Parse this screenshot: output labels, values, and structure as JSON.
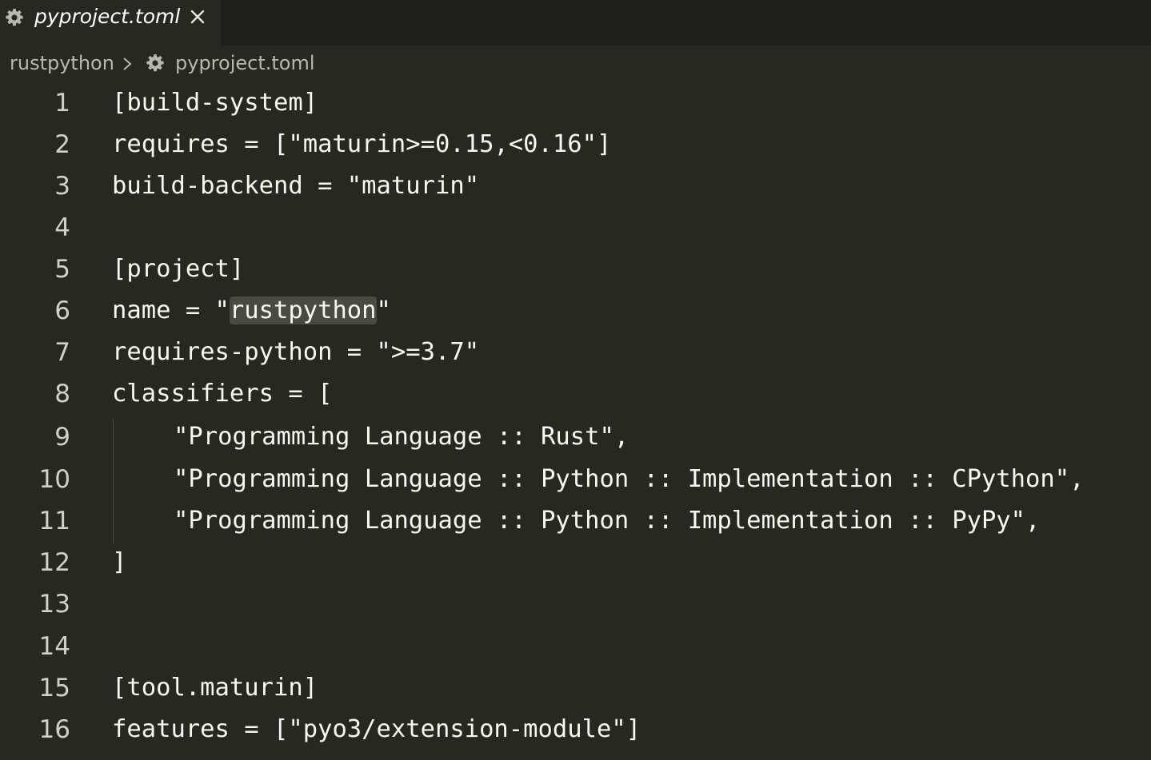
{
  "tab": {
    "title": "pyproject.toml",
    "gear_icon": "gear-icon",
    "close_icon": "close-icon"
  },
  "breadcrumb": {
    "root": "rustpython",
    "separator_icon": "chevron-right-icon",
    "file_icon": "gear-icon",
    "file": "pyproject.toml"
  },
  "colors": {
    "editor_bg": "#272822",
    "tabbar_bg": "#1e1f1c",
    "text": "#f8f8f2",
    "line_number": "#d0d0c8",
    "selection": "#4a4a44"
  },
  "editor": {
    "lines": [
      {
        "num": "1",
        "text": "[build-system]"
      },
      {
        "num": "2",
        "text": "requires = [\"maturin>=0.15,<0.16\"]"
      },
      {
        "num": "3",
        "text": "build-backend = \"maturin\""
      },
      {
        "num": "4",
        "text": ""
      },
      {
        "num": "5",
        "text": "[project]"
      },
      {
        "num": "6",
        "text_before": "name = \"",
        "text_highlight": "rustpython",
        "text_after": "\""
      },
      {
        "num": "7",
        "text": "requires-python = \">=3.7\""
      },
      {
        "num": "8",
        "text": "classifiers = ["
      },
      {
        "num": "9",
        "text": "\"Programming Language :: Rust\","
      },
      {
        "num": "10",
        "text": "\"Programming Language :: Python :: Implementation :: CPython\","
      },
      {
        "num": "11",
        "text": "\"Programming Language :: Python :: Implementation :: PyPy\","
      },
      {
        "num": "12",
        "text": "]"
      },
      {
        "num": "13",
        "text": ""
      },
      {
        "num": "14",
        "text": ""
      },
      {
        "num": "15",
        "text": "[tool.maturin]"
      },
      {
        "num": "16",
        "text": "features = [\"pyo3/extension-module\"]"
      }
    ]
  }
}
